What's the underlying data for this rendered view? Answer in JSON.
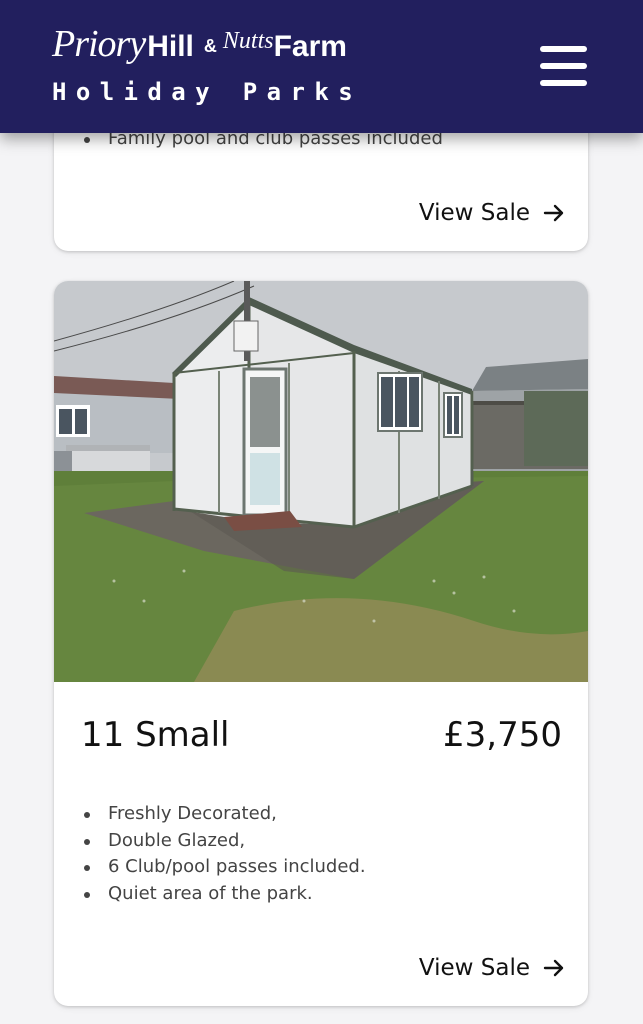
{
  "header": {
    "logo": {
      "priory": "Priory",
      "hill": "Hill",
      "amp": "&",
      "nutts": "Nutts",
      "farm": "Farm",
      "tagline": "Holiday Parks"
    },
    "background_color": "#221f5e",
    "menu_icon": "hamburger-menu-icon"
  },
  "listings": [
    {
      "features": [
        "Family pool and club passes included"
      ],
      "view_sale_label": "View Sale",
      "arrow_icon": "arrow-right-icon"
    },
    {
      "title": "11 Small",
      "price": "£3,750",
      "features": [
        "Freshly Decorated,",
        "Double Glazed,",
        "6 Club/pool passes included.",
        "Quiet area of the park."
      ],
      "view_sale_label": "View Sale",
      "arrow_icon": "arrow-right-icon"
    }
  ]
}
